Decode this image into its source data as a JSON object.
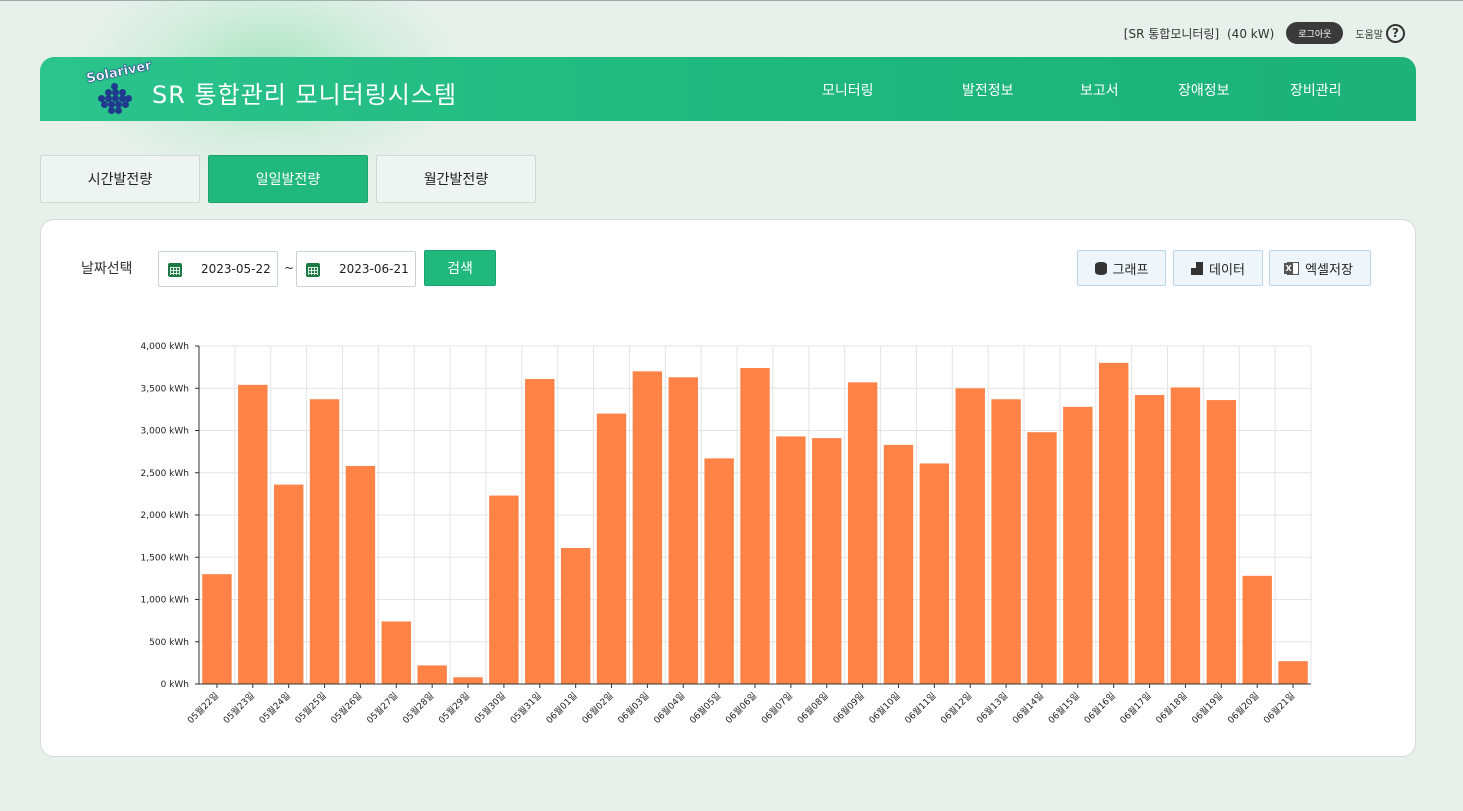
{
  "topbar": {
    "site_name": "[SR 통합모니터링]",
    "capacity": "(40 kW)",
    "logout_label": "로그아웃",
    "help_label": "도움말",
    "help_icon": "?"
  },
  "header": {
    "logo_text": "Solariver",
    "title": "SR 통합관리 모니터링시스템",
    "nav": [
      "모니터링",
      "발전정보",
      "보고서",
      "장애정보",
      "장비관리"
    ]
  },
  "tabs": [
    {
      "label": "시간발전량",
      "active": false
    },
    {
      "label": "일일발전량",
      "active": true
    },
    {
      "label": "월간발전량",
      "active": false
    }
  ],
  "filter": {
    "label": "날짜선택",
    "start_date": "2023-05-22",
    "separator": "~",
    "end_date": "2023-06-21",
    "search_label": "검색"
  },
  "tools": {
    "graph_label": "그래프",
    "data_label": "데이터",
    "excel_label": "엑셀저장"
  },
  "colors": {
    "accent": "#20b87c",
    "bar": "#ff8347",
    "grid": "#e4e4e4"
  },
  "chart_data": {
    "type": "bar",
    "categories": [
      "05월22일",
      "05월23일",
      "05월24일",
      "05월25일",
      "05월26일",
      "05월27일",
      "05월28일",
      "05월29일",
      "05월30일",
      "05월31일",
      "06월01일",
      "06월02일",
      "06월03일",
      "06월04일",
      "06월05일",
      "06월06일",
      "06월07일",
      "06월08일",
      "06월09일",
      "06월10일",
      "06월11일",
      "06월12일",
      "06월13일",
      "06월14일",
      "06월15일",
      "06월16일",
      "06월17일",
      "06월18일",
      "06월19일",
      "06월20일",
      "06월21일"
    ],
    "values": [
      1300,
      3540,
      2360,
      3370,
      2580,
      740,
      220,
      80,
      2230,
      3610,
      1610,
      3200,
      3700,
      3630,
      2670,
      3740,
      2930,
      2910,
      3570,
      2830,
      2610,
      3500,
      3370,
      2980,
      3280,
      3800,
      3420,
      3510,
      3360,
      1280,
      270
    ],
    "yticks": [
      "0 kWh",
      "500 kWh",
      "1,000 kWh",
      "1,500 kWh",
      "2,000 kWh",
      "2,500 kWh",
      "3,000 kWh",
      "3,500 kWh",
      "4,000 kWh"
    ],
    "ylim": [
      0,
      4000
    ],
    "grid": true
  }
}
